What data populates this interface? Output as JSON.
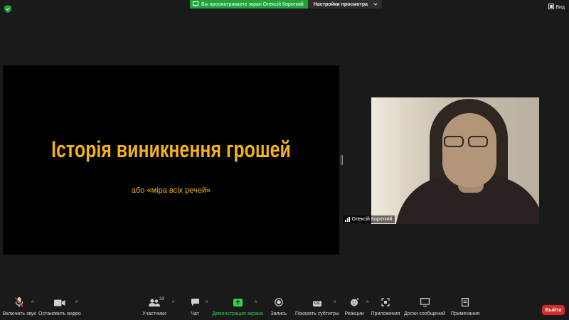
{
  "top_bar": {
    "share_banner_text": "Вы просматриваете экран Олексій Короткий",
    "view_settings_label": "Настройки просмотра",
    "view_label": "Вид"
  },
  "slide": {
    "title": "Історія виникнення грошей",
    "subtitle": "або «міра всіх речей»"
  },
  "video": {
    "participant_name": "Олексій Короткий"
  },
  "toolbar": {
    "mute_label": "Включить звук",
    "stop_video_label": "Остановить видео",
    "participants_label": "Участники",
    "participants_count": "33",
    "chat_label": "Чат",
    "share_screen_label": "Демонстрация экрана",
    "record_label": "Запись",
    "captions_label": "Показать субтитры",
    "captions_icon_text": "CC",
    "reactions_label": "Реакции",
    "apps_label": "Приложения",
    "whiteboard_label": "Доски сообщений",
    "notes_label": "Примечания",
    "leave_label": "Выйти"
  },
  "colors": {
    "slide_text": "#f2b317",
    "share_banner": "#22a33a",
    "leave_button": "#d32b2b",
    "active_label": "#2fd34d"
  },
  "icons": [
    "shield-icon",
    "view-icon",
    "mic-muted-icon",
    "video-camera-icon",
    "participants-icon",
    "chat-icon",
    "share-screen-icon",
    "record-icon",
    "captions-icon",
    "reactions-icon",
    "apps-icon",
    "whiteboard-icon",
    "notes-icon",
    "signal-bars-icon"
  ]
}
